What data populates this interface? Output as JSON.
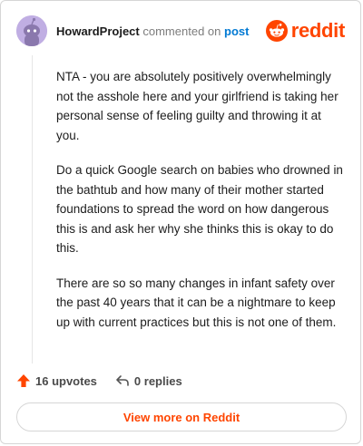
{
  "comment": {
    "username": "HowardProject",
    "action_text": "commented on",
    "post_link": "post",
    "paragraphs": [
      "NTA - you are absolutely positively overwhelmingly not the asshole here and your girlfriend is taking her personal sense of feeling guilty and throwing it at you.",
      "Do a quick Google search on babies who drowned in the bathtub and how many of their mother started foundations to spread the word on how dangerous this is and ask her why she thinks this is okay to do this.",
      "There are so so many changes in infant safety over the past 40 years that it can be a nightmare to keep up with current practices but this is not one of them."
    ]
  },
  "brand": {
    "name": "reddit",
    "color": "#ff4500"
  },
  "actions": {
    "upvotes": "16 upvotes",
    "replies": "0 replies",
    "upvote_icon": "arrow-up-icon",
    "reply_icon": "reply-arrow-icon"
  },
  "cta": {
    "label": "View more on Reddit"
  }
}
